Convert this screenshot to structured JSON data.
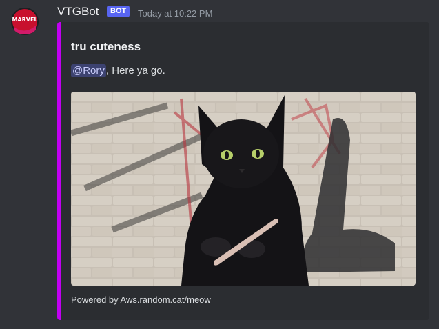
{
  "message": {
    "author": "VTGBot",
    "badge": "BOT",
    "timestamp": "Today at 10:22 PM",
    "avatar_text": "MARVEL"
  },
  "embed": {
    "accent_color": "#c200f2",
    "title": "tru cuteness",
    "mention": "@Rory",
    "description": ", Here ya go.",
    "image_icon": "black-cat-with-nail-file-image",
    "footer": "Powered by Aws.random.cat/meow"
  }
}
